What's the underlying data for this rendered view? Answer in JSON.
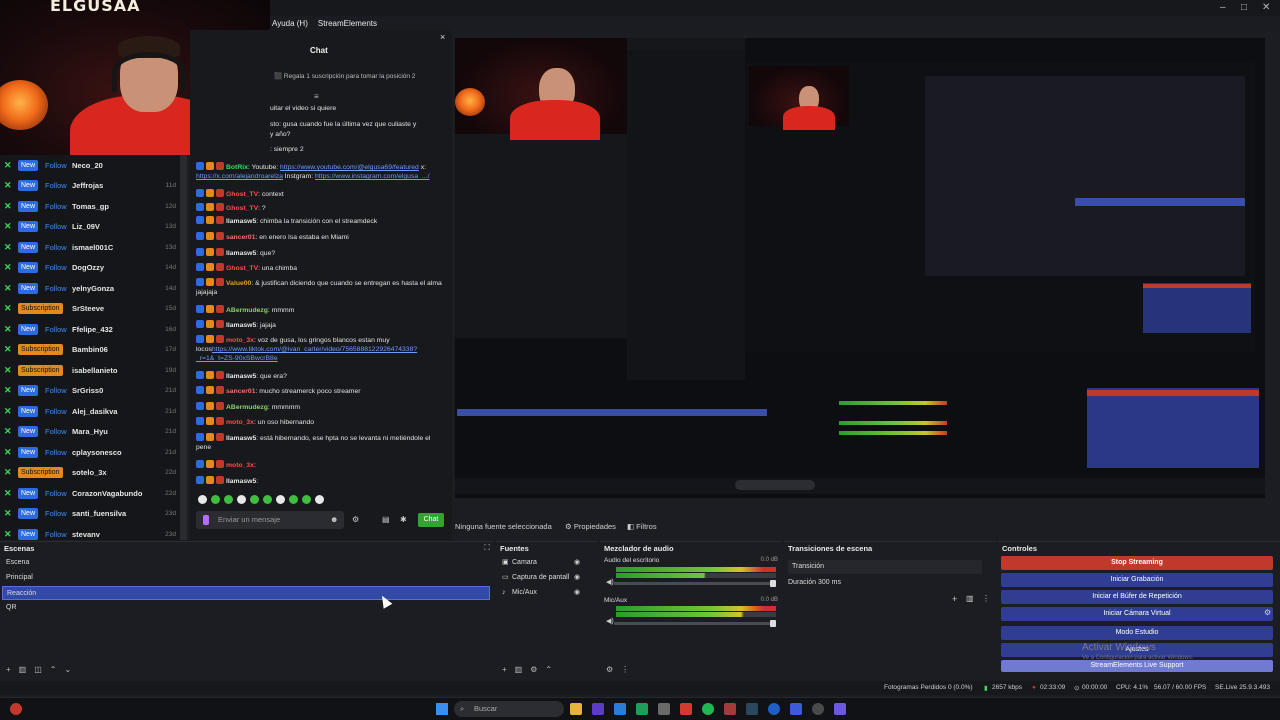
{
  "window": {
    "menu_items": [
      "Ayuda (H)",
      "StreamElements"
    ]
  },
  "webcam": {
    "logo_text": "ELGUSAA"
  },
  "activity_feed": {
    "items": [
      {
        "type": "New",
        "kind": "Follow",
        "name": "Neco_20",
        "age": ""
      },
      {
        "type": "New",
        "kind": "Follow",
        "name": "Jeffrojas",
        "age": "11d"
      },
      {
        "type": "New",
        "kind": "Follow",
        "name": "Tomas_gp",
        "age": "12d"
      },
      {
        "type": "New",
        "kind": "Follow",
        "name": "Liz_09V",
        "age": "13d"
      },
      {
        "type": "New",
        "kind": "Follow",
        "name": "ismael001C",
        "age": "13d"
      },
      {
        "type": "New",
        "kind": "Follow",
        "name": "DogOzzy",
        "age": "14d"
      },
      {
        "type": "New",
        "kind": "Follow",
        "name": "yelnyGonza",
        "age": "14d"
      },
      {
        "type": "Subscription",
        "kind": "",
        "name": "SrSteeve",
        "age": "15d"
      },
      {
        "type": "New",
        "kind": "Follow",
        "name": "Ffelipe_432",
        "age": "16d"
      },
      {
        "type": "Subscription",
        "kind": "",
        "name": "Bambin06",
        "age": "17d"
      },
      {
        "type": "Subscription",
        "kind": "",
        "name": "isabellanieto",
        "age": "19d"
      },
      {
        "type": "New",
        "kind": "Follow",
        "name": "SrGriss0",
        "age": "21d"
      },
      {
        "type": "New",
        "kind": "Follow",
        "name": "Alej_dasikva",
        "age": "21d"
      },
      {
        "type": "New",
        "kind": "Follow",
        "name": "Mara_Hyu",
        "age": "21d"
      },
      {
        "type": "New",
        "kind": "Follow",
        "name": "cplaysonesco",
        "age": "21d"
      },
      {
        "type": "Subscription",
        "kind": "",
        "name": "sotelo_3x",
        "age": "22d"
      },
      {
        "type": "New",
        "kind": "Follow",
        "name": "CorazonVagabundo",
        "age": "22d"
      },
      {
        "type": "New",
        "kind": "Follow",
        "name": "santi_fuensilva",
        "age": "23d"
      },
      {
        "type": "New",
        "kind": "Follow",
        "name": "stevanv",
        "age": "23d"
      }
    ]
  },
  "chat": {
    "title": "Chat",
    "close_icon": "×",
    "pinned": "Regala 1 suscripción para tomar la posición 2",
    "fragments": [
      "uitar el video si quiere",
      "sto: gusa cuando fue la última vez que culiaste y",
      "y año?",
      ": siempre 2"
    ],
    "messages": [
      {
        "user": "BotRix",
        "text": "Youtube: ",
        "link1": "https://www.youtube.com/@elgusa69/featured",
        "mid": " x: ",
        "link2": "https://x.com/alejandroarelza",
        "tail": " Instgram: ",
        "link3": "https://www.instagram.com/elgusa_.../",
        "color": "#3ddc57"
      },
      {
        "user": "Ghost_TV",
        "text": "context",
        "color": "#ff4d4d"
      },
      {
        "user": "Ghost_TV",
        "text": "?",
        "color": "#ff4d4d"
      },
      {
        "user": "llamasw5",
        "text": "chimba la transición con el streamdeck",
        "color": "#e6e6e6"
      },
      {
        "user": "sancer01",
        "text": "en enero Isa estaba en Miami",
        "color": "#ff6a6a"
      },
      {
        "user": "llamasw5",
        "text": "que?",
        "color": "#e6e6e6"
      },
      {
        "user": "Ghost_TV",
        "text": "una chimba",
        "color": "#ff4d4d"
      },
      {
        "user": "Value00",
        "text": "& justifican diciendo que cuando se entregan es hasta el alma jajajaja",
        "color": "#e0a030"
      },
      {
        "user": "ABermudezg",
        "text": "mmmm",
        "color": "#8bd06b"
      },
      {
        "user": "llamasw5",
        "text": "jajaja",
        "color": "#e6e6e6"
      },
      {
        "user": "moto_3x",
        "text": "voz de gusa, los gringos blancos estan muy locos",
        "link1": "https://www.tiktok.com/@ivan_carter/video/7565888122926474338?_r=1&_t=ZS-90xSBwcrB8e",
        "color": "#ff4d4d"
      },
      {
        "user": "llamasw5",
        "text": "que era?",
        "color": "#e6e6e6"
      },
      {
        "user": "sancer01",
        "text": "mucho streamerck poco streamer",
        "color": "#ff6a6a"
      },
      {
        "user": "ABermudezg",
        "text": "mmmmm",
        "color": "#8bd06b"
      },
      {
        "user": "moto_3x",
        "text": "un oso hibernando",
        "color": "#ff4d4d"
      },
      {
        "user": "llamasw5",
        "text": "está hibernando, ese hpta no se levanta ni metiéndole el pene",
        "color": "#e6e6e6"
      },
      {
        "user": "moto_3x",
        "text": "",
        "color": "#ff4d4d"
      },
      {
        "user": "llamasw5",
        "text": "",
        "color": "#e6e6e6"
      }
    ],
    "input_placeholder": "Enviar un mensaje",
    "send_label": "Chat"
  },
  "preview_status": {
    "no_source": "Ninguna fuente seleccionada",
    "properties": "Propiedades",
    "filters": "Filtros"
  },
  "scenes": {
    "title": "Escenas",
    "items": [
      "Escena",
      "Principal",
      "Reacción",
      "QR"
    ],
    "selected_index": 2
  },
  "sources": {
    "title": "Fuentes",
    "items": [
      "Camara",
      "Captura de pantall",
      "Mic/Aux"
    ]
  },
  "mixer": {
    "title": "Mezclador de audio",
    "channels": [
      {
        "name": "Audio del escritorio",
        "db": "0.0 dB"
      },
      {
        "name": "Mic/Aux",
        "db": "0.0 dB"
      }
    ],
    "scale": [
      "-60",
      "-55",
      "-50",
      "-45",
      "-40",
      "-35",
      "-30",
      "-25",
      "-20",
      "-15",
      "-10",
      "-5",
      "0"
    ]
  },
  "transitions": {
    "title": "Transiciones de escena",
    "selected": "Transición",
    "duration_label": "Duración",
    "duration_value": "300 ms"
  },
  "controls": {
    "title": "Controles",
    "buttons": [
      "Stop Streaming",
      "Iniciar Grabación",
      "Iniciar el Búfer de Repetición",
      "Iniciar Cámara Virtual",
      "Modo Estudio",
      "Ajustes"
    ],
    "footer": "StreamElements Live Support",
    "watermark": "Activar Windows",
    "watermark_sub": "Ve a Configuración para activar Windows."
  },
  "statusbar": {
    "dropped": "Fotogramas Perdidos 0 (0.0%)",
    "bitrate": "2657 kbps",
    "time": "02:33:09",
    "rec_time": "00:00:00",
    "cpu": "CPU: 4.1%",
    "fps": "56.07 / 60.00 FPS",
    "se": "SE.Live 25.9.3.493"
  },
  "taskbar": {
    "search_placeholder": "Buscar"
  },
  "colors": {
    "accent_blue": "#3349a6",
    "stop_red": "#c0392b",
    "follow_blue": "#2d6be0",
    "sub_orange": "#e28a1f",
    "chat_green": "#2fa52f"
  }
}
